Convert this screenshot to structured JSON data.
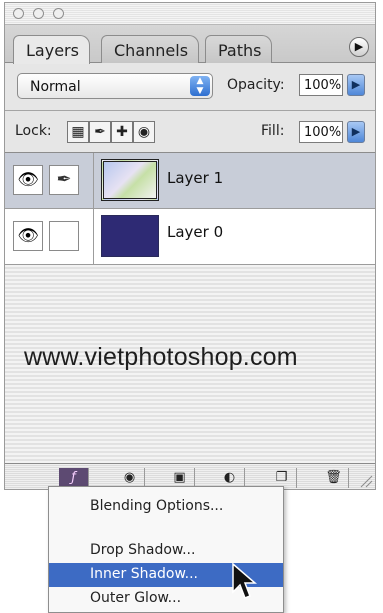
{
  "window": {
    "controls": [
      "close",
      "minimize",
      "zoom"
    ]
  },
  "tabs": [
    {
      "label": "Layers",
      "active": true
    },
    {
      "label": "Channels",
      "active": false
    },
    {
      "label": "Paths",
      "active": false
    }
  ],
  "panel_menu_icon": "triangle-right-icon",
  "blend": {
    "mode": "Normal",
    "opacity_label": "Opacity:",
    "opacity_value": "100%"
  },
  "lock": {
    "label": "Lock:",
    "icons": [
      "transparency-lock-icon",
      "brush-lock-icon",
      "move-lock-icon",
      "padlock-icon"
    ],
    "fill_label": "Fill:",
    "fill_value": "100%"
  },
  "layers": [
    {
      "name": "Layer 1",
      "selected": true,
      "visible": true,
      "linked_icon": "brush-icon"
    },
    {
      "name": "Layer 0",
      "selected": false,
      "visible": true
    }
  ],
  "watermark": "www.vietphotoshop.com",
  "bottom_bar": {
    "buttons": [
      "fx-icon",
      "mask-icon",
      "folder-icon",
      "adjustment-icon",
      "new-layer-icon",
      "trash-icon"
    ]
  },
  "popup_menu": {
    "items": [
      {
        "label": "Blending Options...",
        "highlighted": false
      },
      {
        "label": "Drop Shadow...",
        "highlighted": false
      },
      {
        "label": "Inner Shadow...",
        "highlighted": true
      },
      {
        "label": "Outer Glow...",
        "highlighted": false
      }
    ]
  },
  "colors": {
    "selection": "#3d6bc4",
    "layer0_fill": "#2e2a74",
    "selected_row": "#c8cdd8"
  }
}
